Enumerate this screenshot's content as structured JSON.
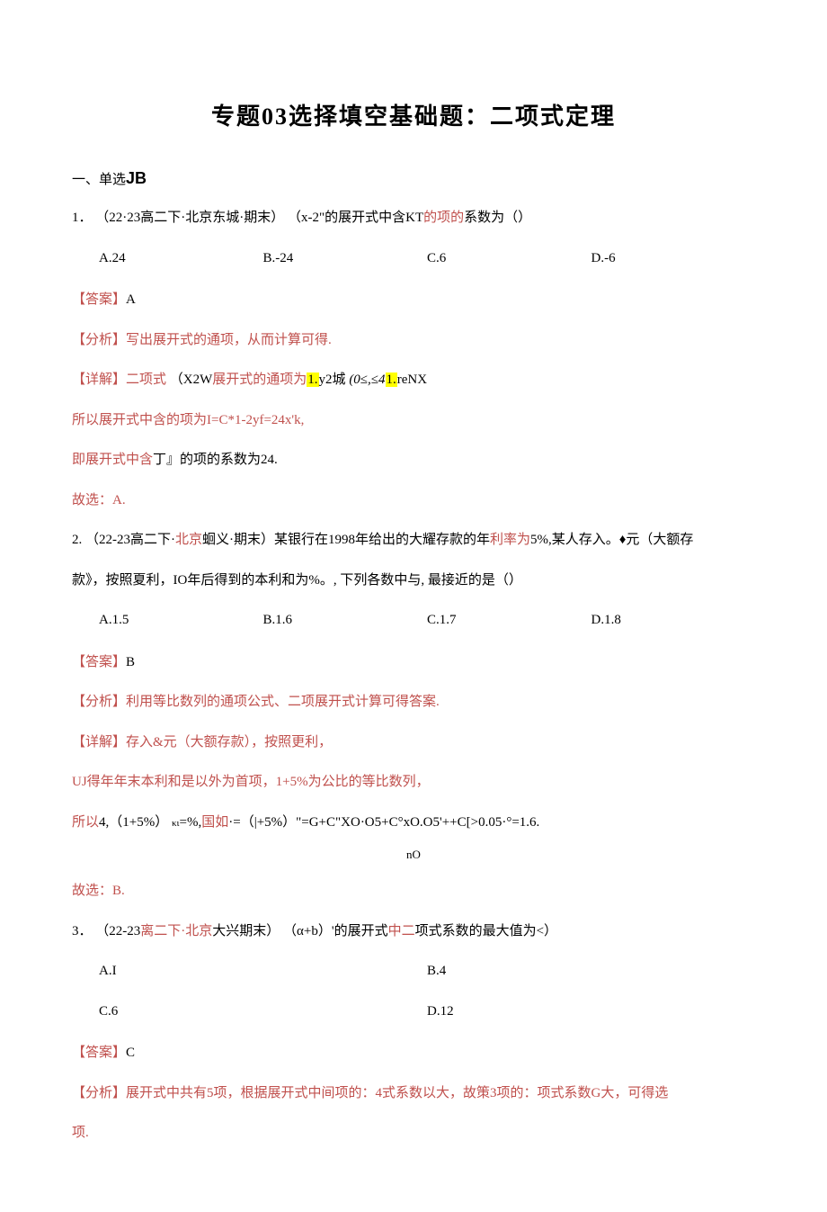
{
  "title": "专题03选择填空基础题：二项式定理",
  "sectionHeader": {
    "prefix": "一、单选",
    "bold": "JB"
  },
  "q1": {
    "num": "1．",
    "source": "（22·23高二下·北京东城·期末）",
    "stem": " （x-2\"的展开式中含KT",
    "stemRed": "的项的",
    "stemEnd": "系数为（）",
    "opts": {
      "a": "A.24",
      "b": "B.-24",
      "c": "C.6",
      "d": "D.-6"
    },
    "ans": {
      "label": "【答案】",
      "val": "A"
    },
    "ana": {
      "label": "【分析】",
      "text": "写出展开式的通项，从而计算可得."
    },
    "det": {
      "label": "【详解】",
      "pre": "二项式",
      "mid": " （X2W",
      "mid2": "展开式的通项为",
      "hl1": "1.",
      "mid3": "y2城 ",
      "ital": "(0≤,≤4",
      "hl2": "1.",
      "end": "reNX"
    },
    "line1": "所以展开式中含的项为I=C*1-2yf=24x'k,",
    "line2a": "即展开式中含",
    "line2b": "丁』的项的系数为24.",
    "choose": "故选：A."
  },
  "q2": {
    "num": "2.",
    "src1": "（22-23高二下·",
    "src2": "北京",
    "src3": "蛔义·期末）某银行在1998年给出的大耀存款的年",
    "src4": "利率为",
    "src5": "5%,某人存入。♦元（大额存",
    "line2": "款》，按照夏利，IO年后得到的本利和为%。, 下列各数中与, 最接近的是（）",
    "opts": {
      "a": "A.1.5",
      "b": "B.1.6",
      "c": "C.1.7",
      "d": "D.1.8"
    },
    "ans": {
      "label": "【答案】",
      "val": "B"
    },
    "ana": {
      "label": "【分析】",
      "text": "利用等比数列的通项公式、二项展开式计算可得答案."
    },
    "det": {
      "label": "【详解】",
      "text": "存入&元（大额存款），按照更利，"
    },
    "line3": "UJ得年年末本利和是以外为首项，1+5%为公比的等比数列，",
    "line4a": "所以",
    "line4b": "4,（1+5%）",
    "line4c": "κι",
    "line4d": "=%,",
    "line4e": "国如",
    "line4f": "·=（|+5%）\"=G+C\"XO·O5+C°xO.O5'++C[>0.05·°=1.6.",
    "sub": "nO",
    "choose": "故选：B."
  },
  "q3": {
    "num": "3．",
    "src1": "（22-23",
    "src2": "离二下·",
    "src3": "北京",
    "src4": "大兴期末）",
    "stem": " （α+b）'的展开式",
    "stemR": "中二",
    "stemE": "项式系数的最大值为<）",
    "opts": {
      "a": "A.I",
      "b": "B.4",
      "c": "C.6",
      "d": "D.12"
    },
    "ans": {
      "label": "【答案】",
      "val": "C"
    },
    "ana": {
      "label": "【分析】",
      "text": "展开式中共有5项，根据展开式中间项的：4式系数以大，故策3项的：项式系数G大，可得选"
    },
    "anaEnd": "项."
  }
}
